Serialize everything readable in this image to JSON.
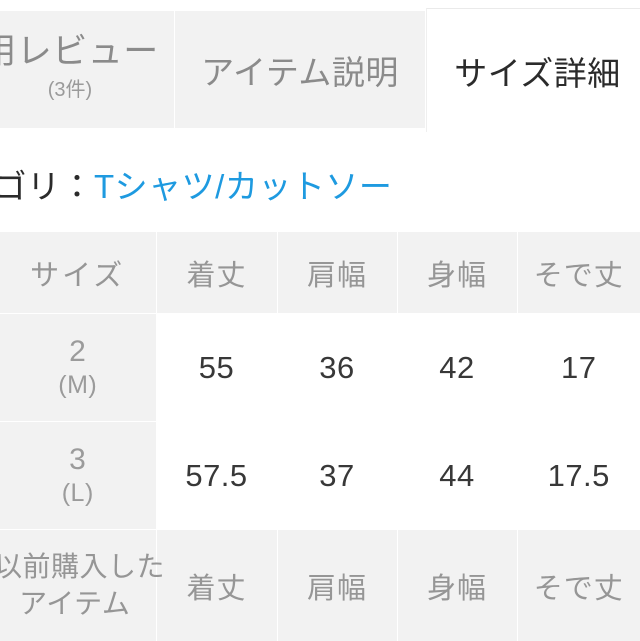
{
  "tabs": [
    {
      "id": "review",
      "label": "用レビュー",
      "sub": "(3件)",
      "active": false
    },
    {
      "id": "item-description",
      "label": "アイテム説明",
      "sub": "",
      "active": false
    },
    {
      "id": "size-details",
      "label": "サイズ詳細",
      "sub": "",
      "active": true
    }
  ],
  "category": {
    "label": "テゴリ：",
    "link": "Tシャツ/カットソー",
    "link_color": "#1e9ae0"
  },
  "size_table": {
    "headers": [
      "サイズ",
      "着丈",
      "肩幅",
      "身幅",
      "そで丈"
    ],
    "rows": [
      {
        "size_num": "2",
        "size_alias": "(M)",
        "values": [
          "55",
          "36",
          "42",
          "17"
        ]
      },
      {
        "size_num": "3",
        "size_alias": "(L)",
        "values": [
          "57.5",
          "37",
          "44",
          "17.5"
        ]
      }
    ]
  },
  "previous_items_table": {
    "headers": [
      "着丈",
      "肩幅",
      "身幅",
      "そで丈"
    ],
    "title_line1": "以前購入した",
    "title_line2": "アイテム"
  },
  "colors": {
    "tab_inactive_bg": "#f2f2f2",
    "tab_active_bg": "#ffffff",
    "text_muted": "#969696",
    "text_dark": "#2b2b2b",
    "link": "#1e9ae0",
    "cell_bg": "#ffffff",
    "header_bg": "#f2f2f2"
  }
}
